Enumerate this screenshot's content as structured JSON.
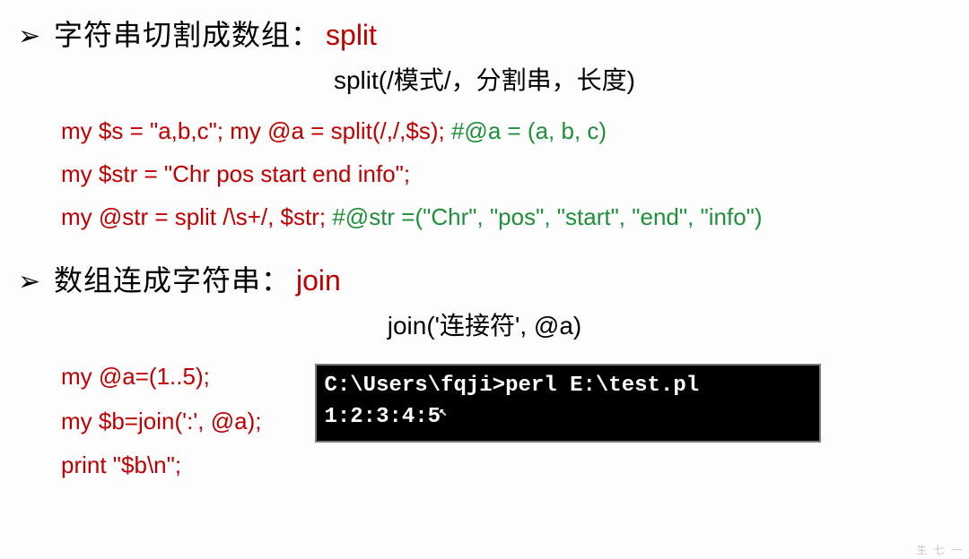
{
  "section1": {
    "bullet": "➢",
    "title": "字符串切割成数组：",
    "keyword": "split",
    "syntax": "split(/模式/，分割串，长度)",
    "line1_code": "my $s = \"a,b,c\";  my @a = split(/,/,$s);",
    "line1_comment": "   #@a = (a, b, c)",
    "line2_code": "my $str = \"Chr   pos    start    end    info\";",
    "line3_code": "my @str = split /\\s+/, $str;",
    "line3_comment": "   #@str =(\"Chr\", \"pos\", \"start\", \"end\", \"info\")"
  },
  "section2": {
    "bullet": "➢",
    "title": "数组连成字符串：",
    "keyword": "join",
    "syntax": "join('连接符', @a)",
    "code1": "my @a=(1..5);",
    "code2": "my $b=join(':', @a);",
    "code3": "print \"$b\\n\";"
  },
  "terminal": {
    "line1": "C:\\Users\\fqji>perl E:\\test.pl",
    "line2": "1:2:3:4:5"
  },
  "watermark": "生 七 一"
}
